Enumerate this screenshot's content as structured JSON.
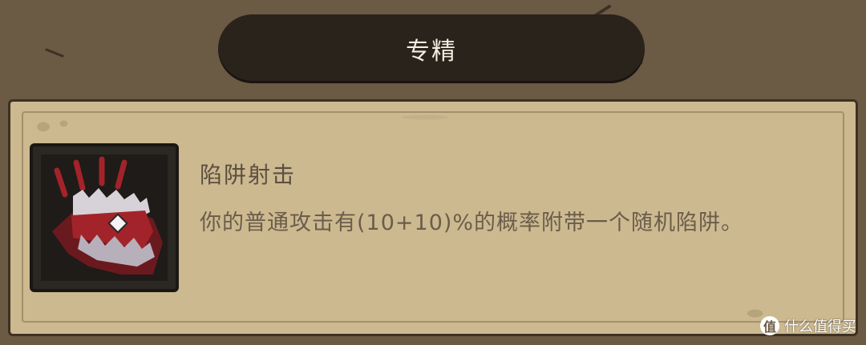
{
  "header": {
    "title": "专精"
  },
  "skill": {
    "name": "陷阱射击",
    "description": "你的普通攻击有(10+10)%的概率附带一个随机陷阱。",
    "icon": "trap-jaw-icon"
  },
  "watermark": {
    "text": "什么值得买",
    "logo": "值"
  },
  "colors": {
    "background": "#6b5a44",
    "banner": "#2a231b",
    "panel": "#cdb990",
    "icon_red": "#a3232a"
  }
}
